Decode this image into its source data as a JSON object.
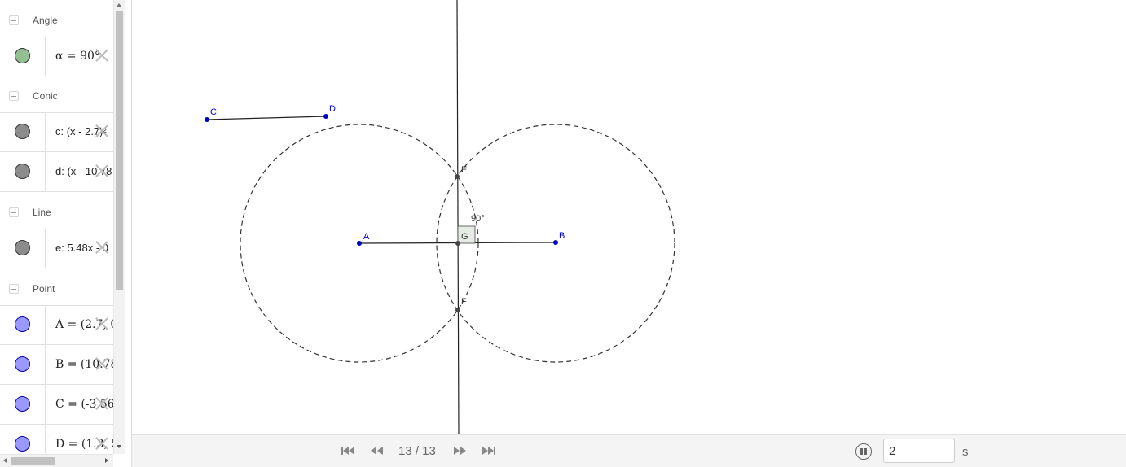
{
  "algebra": {
    "groups": [
      {
        "title": "Angle",
        "items": [
          {
            "text": "α = 90°",
            "color": "#93bf93"
          }
        ]
      },
      {
        "title": "Conic",
        "items": [
          {
            "text": "c: (x - 2.7)²",
            "color": "#8c8c8c"
          },
          {
            "text": "d: (x - 10.78",
            "color": "#8c8c8c"
          }
        ]
      },
      {
        "title": "Line",
        "items": [
          {
            "text": "e: 5.48x - 0",
            "color": "#8c8c8c"
          }
        ]
      },
      {
        "title": "Point",
        "items": [
          {
            "text": "A = (2.7, 0.",
            "color": "#9999ff"
          },
          {
            "text": "B = (10.78,",
            "color": "#9999ff"
          },
          {
            "text": "C = (-3.56,",
            "color": "#9999ff"
          },
          {
            "text": "D = (1.3, 5.",
            "color": "#9999ff"
          }
        ]
      }
    ]
  },
  "graphics": {
    "points": [
      {
        "label": "A",
        "color": "#0000cc"
      },
      {
        "label": "B",
        "color": "#0000cc"
      },
      {
        "label": "C",
        "color": "#0000cc"
      },
      {
        "label": "D",
        "color": "#0000cc"
      },
      {
        "label": "E",
        "color": "#333333"
      },
      {
        "label": "F",
        "color": "#333333"
      },
      {
        "label": "G",
        "color": "#333333"
      }
    ],
    "angle_label": "90°"
  },
  "playbar": {
    "step": "13 / 13",
    "speed": "2",
    "unit": "s",
    "icons": [
      "skip-first-icon",
      "step-back-icon",
      "step-forward-icon",
      "skip-last-icon",
      "pause-icon"
    ]
  }
}
